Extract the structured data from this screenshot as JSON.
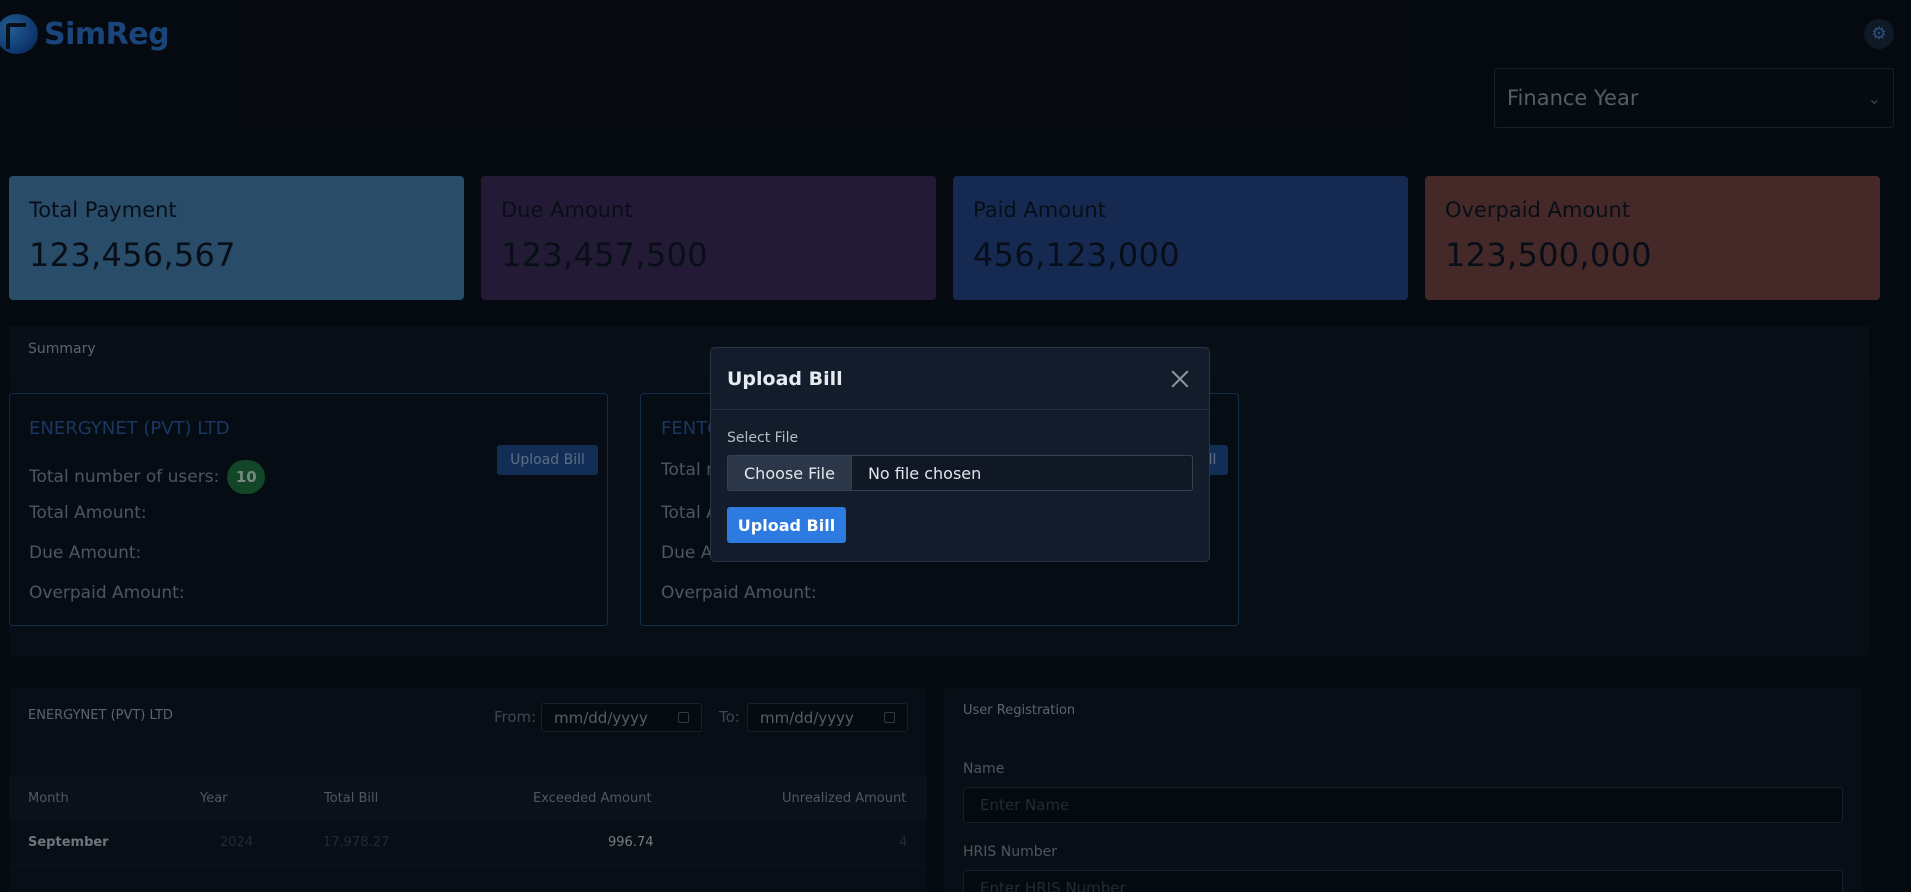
{
  "app": {
    "brand": "SimReg",
    "settings_icon": "gear-icon"
  },
  "filter": {
    "finance_year_placeholder": "Finance Year"
  },
  "stats": [
    {
      "label": "Total Payment",
      "value": "123,456,567",
      "color": "#4682b4"
    },
    {
      "label": "Due Amount",
      "value": "123,457,500",
      "color": "#3e2a58"
    },
    {
      "label": "Paid Amount",
      "value": "456,123,000",
      "color": "#26478a"
    },
    {
      "label": "Overpaid Amount",
      "value": "123,500,000",
      "color": "#7a4540"
    }
  ],
  "summary": {
    "title": "Summary",
    "companies": [
      {
        "name": "ENERGYNET (PVT) LTD",
        "users_label": "Total number of users:",
        "users_count": "10",
        "total_amount_label": "Total Amount:",
        "due_amount_label": "Due Amount:",
        "overpaid_label": "Overpaid Amount:",
        "upload_label": "Upload Bill"
      },
      {
        "name": "FENTO",
        "users_label": "Total n",
        "total_amount_label": "Total A",
        "due_amount_label": "Due An",
        "overpaid_label": "Overpaid Amount:",
        "upload_label": "ll"
      }
    ]
  },
  "bills_table": {
    "title": "ENERGYNET (PVT) LTD",
    "from_label": "From:",
    "to_label": "To:",
    "from_placeholder": "mm/dd/yyyy",
    "to_placeholder": "mm/dd/yyyy",
    "columns": [
      "Month",
      "Year",
      "Total Bill",
      "Exceeded Amount",
      "Unrealized Amount"
    ],
    "rows": [
      {
        "month": "September",
        "year": "2024",
        "total_bill": "17,978.27",
        "exceeded": "996.74",
        "unrealized": "4"
      }
    ]
  },
  "registration": {
    "title": "User Registration",
    "name_label": "Name",
    "name_placeholder": "Enter Name",
    "hris_label": "HRIS Number",
    "hris_placeholder": "Enter HRIS Number"
  },
  "modal": {
    "title": "Upload Bill",
    "field_label": "Select File",
    "choose_file_label": "Choose File",
    "file_status": "No file chosen",
    "submit_label": "Upload Bill"
  }
}
